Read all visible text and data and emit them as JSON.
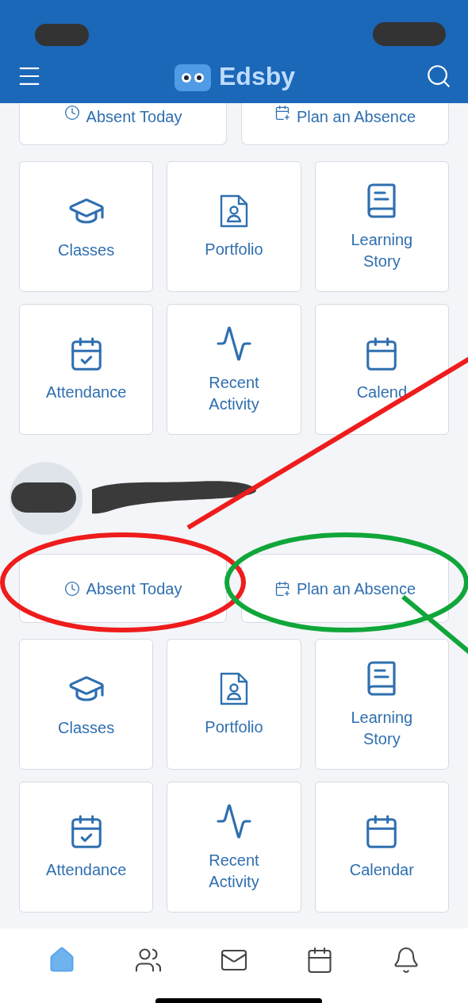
{
  "header": {
    "title": "Edsby"
  },
  "sections": [
    {
      "kind": "actions",
      "cut": true,
      "items": [
        {
          "label": "Absent Today",
          "kind": "clock"
        },
        {
          "label": "Plan an Absence",
          "kind": "plan"
        }
      ]
    },
    {
      "kind": "tiles",
      "items": [
        {
          "label": "Classes",
          "kind": "cap"
        },
        {
          "label": "Portfolio",
          "kind": "portfolio"
        },
        {
          "label": "Learning Story",
          "kind": "book"
        },
        {
          "label": "Attendance",
          "kind": "attendance"
        },
        {
          "label": "Recent Activity",
          "kind": "activity"
        },
        {
          "label": "Calend",
          "kind": "calendar"
        }
      ]
    },
    {
      "kind": "profile"
    },
    {
      "kind": "actions",
      "cut": false,
      "items": [
        {
          "label": "Absent Today",
          "kind": "clock"
        },
        {
          "label": "Plan an Absence",
          "kind": "plan"
        }
      ]
    },
    {
      "kind": "tiles",
      "items": [
        {
          "label": "Classes",
          "kind": "cap"
        },
        {
          "label": "Portfolio",
          "kind": "portfolio"
        },
        {
          "label": "Learning Story",
          "kind": "book"
        },
        {
          "label": "Attendance",
          "kind": "attendance"
        },
        {
          "label": "Recent Activity",
          "kind": "activity"
        },
        {
          "label": "Calendar",
          "kind": "calendar"
        }
      ]
    }
  ],
  "bottom_nav": [
    {
      "kind": "home",
      "selected": true
    },
    {
      "kind": "people",
      "selected": false
    },
    {
      "kind": "mail",
      "selected": false
    },
    {
      "kind": "calendar",
      "selected": false
    },
    {
      "kind": "bell",
      "selected": false
    }
  ],
  "annotations": [
    {
      "kind": "ellipse",
      "color": "#ee1c1c"
    },
    {
      "kind": "line",
      "color": "#ee1c1c"
    },
    {
      "kind": "ellipse",
      "color": "#10a63a"
    },
    {
      "kind": "line",
      "color": "#10a63a"
    }
  ]
}
